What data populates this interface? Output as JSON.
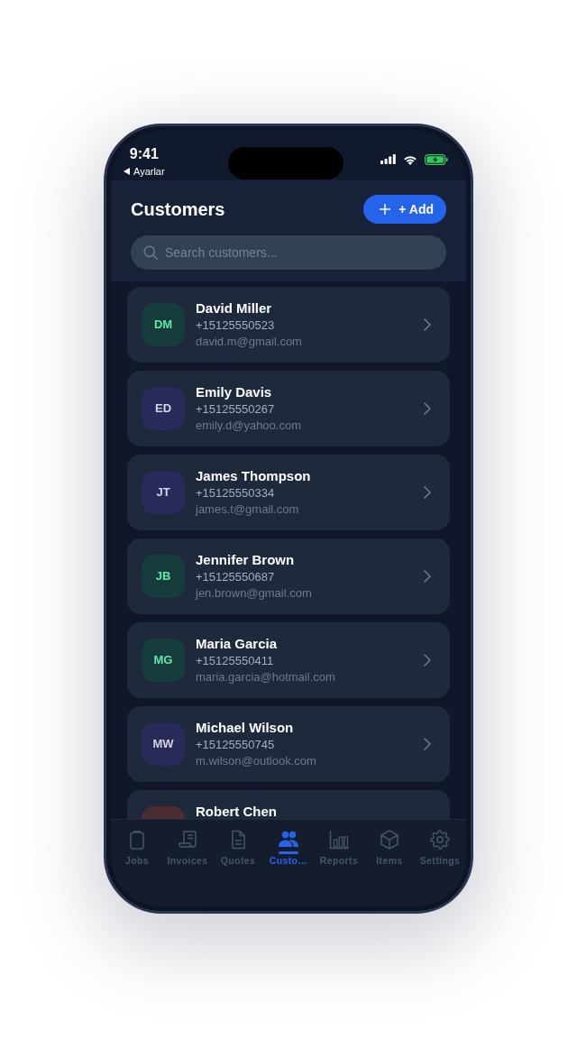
{
  "status_bar": {
    "time": "9:41",
    "back_label": "Ayarlar"
  },
  "header": {
    "title": "Customers",
    "add_button": "+ Add",
    "search": {
      "placeholder": "Search customers..."
    }
  },
  "customers": [
    {
      "name": "David Miller",
      "phone": "+15125550523",
      "email": "david.m@gmail.com",
      "avatar": {
        "color": "#173c3d",
        "initials": {
          "text": "DM",
          "color": "#5ee8a6"
        }
      }
    },
    {
      "name": "Emily Davis",
      "phone": "+15125550267",
      "email": "emily.d@yahoo.com",
      "avatar": {
        "color": "#29295a",
        "initials": {
          "text": "ED",
          "color": "#d3d5e6"
        }
      }
    },
    {
      "name": "James Thompson",
      "phone": "+15125550334",
      "email": "james.t@gmail.com",
      "avatar": {
        "color": "#29295a",
        "initials": {
          "text": "JT",
          "color": "#d3d5e6"
        }
      }
    },
    {
      "name": "Jennifer Brown",
      "phone": "+15125550687",
      "email": "jen.brown@gmail.com",
      "avatar": {
        "color": "#173c3d",
        "initials": {
          "text": "JB",
          "color": "#5ee8a6"
        }
      }
    },
    {
      "name": "Maria Garcia",
      "phone": "+15125550411",
      "email": "maria.garcia@hotmail.com",
      "avatar": {
        "color": "#173c3d",
        "initials": {
          "text": "MG",
          "color": "#5ee8a6"
        }
      }
    },
    {
      "name": "Michael Wilson",
      "phone": "+15125550745",
      "email": "m.wilson@outlook.com",
      "avatar": {
        "color": "#29295a",
        "initials": {
          "text": "MW",
          "color": "#d3d5e6"
        }
      }
    },
    {
      "name": "Robert Chen",
      "avatar": {
        "color": "#4b2d31"
      }
    }
  ],
  "tab_bar": [
    {
      "label": "Jobs",
      "selected": false
    },
    {
      "label": "Invoices",
      "selected": false
    },
    {
      "label": "Quotes",
      "selected": false
    },
    {
      "label": "Custo…",
      "selected": true
    },
    {
      "label": "Reports",
      "selected": false
    },
    {
      "label": "Items",
      "selected": false
    },
    {
      "label": "Settings",
      "selected": false
    }
  ]
}
